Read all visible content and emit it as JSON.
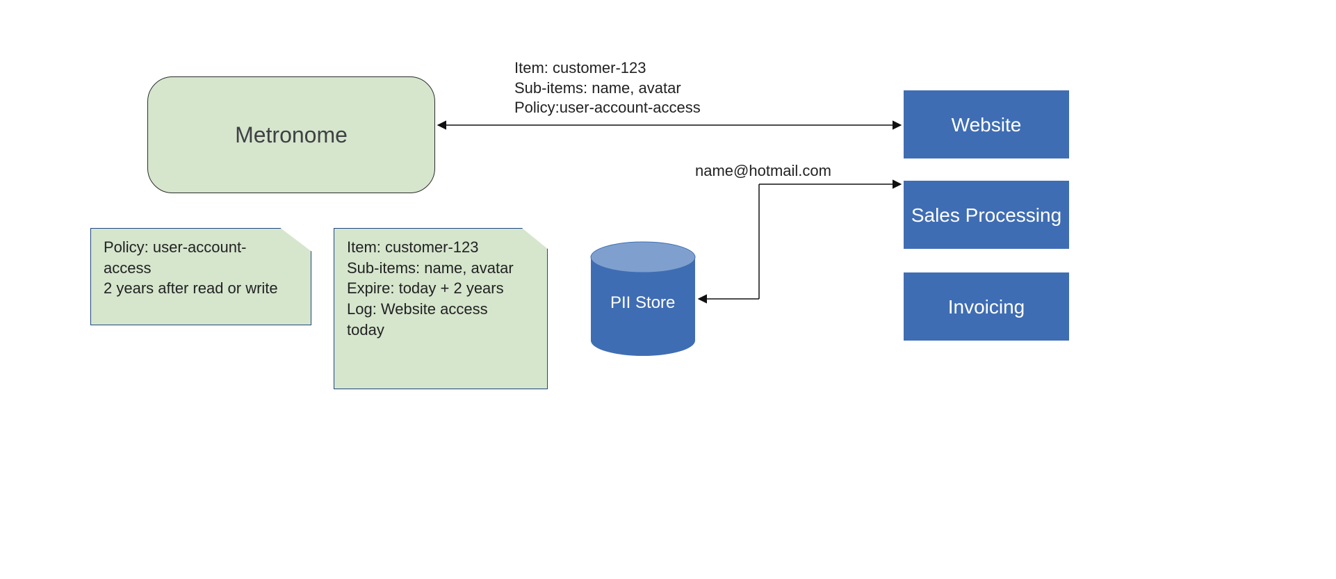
{
  "nodes": {
    "metronome": "Metronome",
    "pii_store": "PII Store",
    "website": "Website",
    "sales_processing": "Sales Processing",
    "invoicing": "Invoicing"
  },
  "notes": {
    "policy_note_line1": "Policy: user-account-",
    "policy_note_line2": "access",
    "policy_note_line3": "2 years after read or write",
    "item_note_line1": "Item: customer-123",
    "item_note_line2": "Sub-items: name, avatar",
    "item_note_line3": "Expire: today + 2 years",
    "item_note_line4": "Log: Website access",
    "item_note_line5": "today"
  },
  "edge_labels": {
    "top_line1": "Item: customer-123",
    "top_line2": "Sub-items: name, avatar",
    "top_line3": "Policy:user-account-access",
    "email": "name@hotmail.com"
  },
  "colors": {
    "green_fill": "#d6e6cd",
    "blue_fill": "#3f6db3",
    "blue_border": "#1c4580",
    "cylinder_side": "#3f6db3",
    "cylinder_top": "#7fa0ce"
  }
}
